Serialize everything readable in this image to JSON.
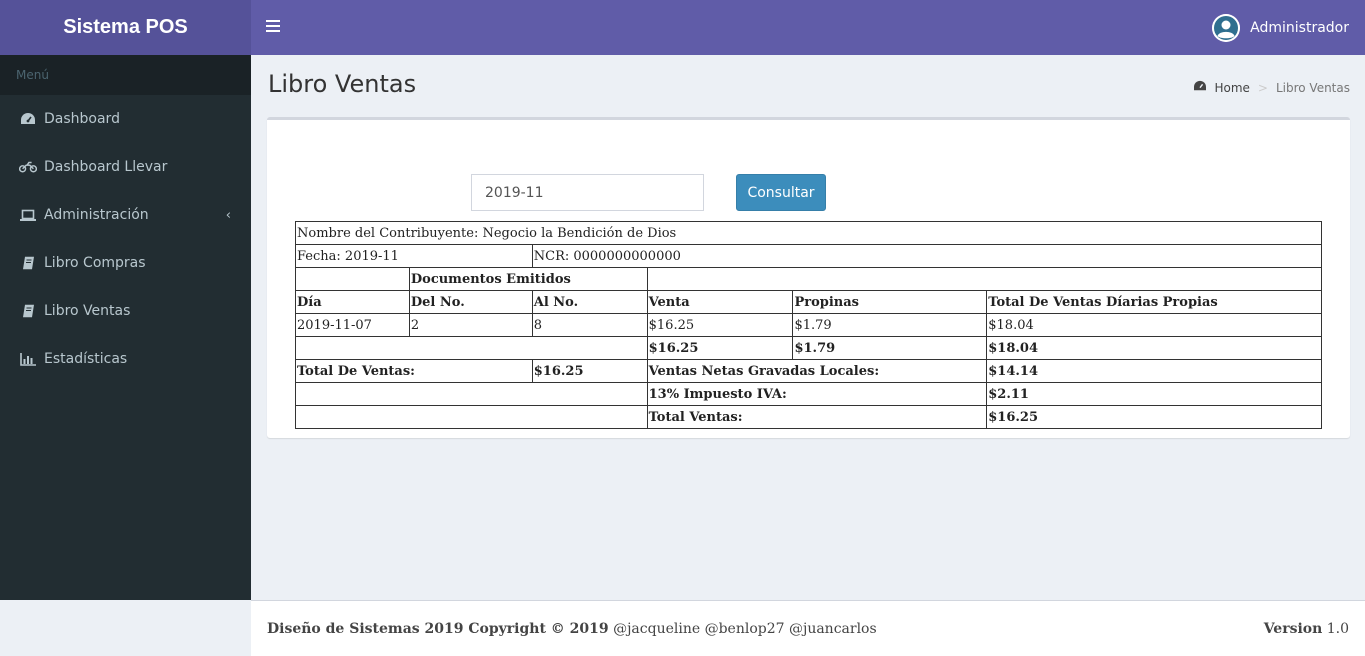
{
  "app": {
    "title": "Sistema POS"
  },
  "header": {
    "user_name": "Administrador"
  },
  "sidebar": {
    "section_label": "Menú",
    "items": [
      {
        "label": "Dashboard",
        "icon": "dashboard-icon"
      },
      {
        "label": "Dashboard Llevar",
        "icon": "motorcycle-icon"
      },
      {
        "label": "Administración",
        "icon": "laptop-icon"
      },
      {
        "label": "Libro Compras",
        "icon": "book-icon"
      },
      {
        "label": "Libro Ventas",
        "icon": "book-icon"
      },
      {
        "label": "Estadísticas",
        "icon": "bar-chart-icon"
      }
    ]
  },
  "page": {
    "title": "Libro Ventas",
    "breadcrumb": {
      "home": "Home",
      "current": "Libro Ventas"
    }
  },
  "filter": {
    "month_value": "2019-11",
    "button_label": "Consultar"
  },
  "report": {
    "contribuyente": "Nombre del Contribuyente: Negocio la Bendición de Dios",
    "fecha": "Fecha: 2019-11",
    "ncr": "NCR: 0000000000000",
    "documentos_emitidos": "Documentos Emitidos",
    "headers": {
      "dia": "Día",
      "del_no": "Del No.",
      "al_no": "Al No.",
      "venta": "Venta",
      "propinas": "Propinas",
      "total_diarias": "Total De Ventas Díarias Propias"
    },
    "rows": [
      {
        "dia": "2019-11-07",
        "del_no": "2",
        "al_no": "8",
        "venta": "$16.25",
        "propinas": "$1.79",
        "total": "$18.04"
      }
    ],
    "sum_venta": "$16.25",
    "sum_propinas": "$1.79",
    "sum_total": "$18.04",
    "total_ventas_label": "Total De Ventas:",
    "total_ventas_value": "$16.25",
    "netas_label": "Ventas Netas Gravadas Locales:",
    "netas_value": "$14.14",
    "iva_label": "13% Impuesto IVA:",
    "iva_value": "$2.11",
    "final_label": "Total Ventas:",
    "final_value": "$16.25"
  },
  "footer": {
    "copyright": "Diseño de Sistemas 2019 Copyright © 2019",
    "authors": "@jacqueline @benlop27 @juancarlos",
    "version_label": "Version",
    "version_number": "1.0"
  }
}
